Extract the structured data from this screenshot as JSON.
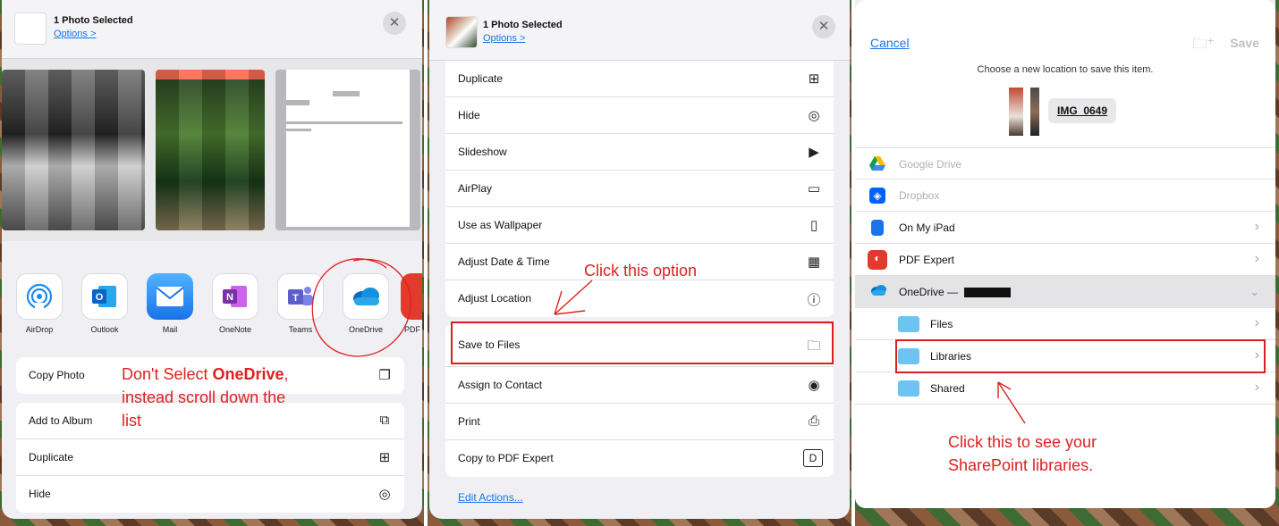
{
  "share_sheet": {
    "title": "1 Photo Selected",
    "options_link": "Options >",
    "close_glyph": "✕",
    "apps": [
      {
        "label": "AirDrop",
        "icon": "airdrop-icon",
        "color": "#ffffff"
      },
      {
        "label": "Outlook",
        "icon": "outlook-icon",
        "color": "#0a64c8"
      },
      {
        "label": "Mail",
        "icon": "mail-icon",
        "color": "#2b8cf5"
      },
      {
        "label": "OneNote",
        "icon": "onenote-icon",
        "color": "#7b2fa8"
      },
      {
        "label": "Teams",
        "icon": "teams-icon",
        "color": "#5b5fc7"
      },
      {
        "label": "OneDrive",
        "icon": "onedrive-icon",
        "color": "#0f6cbd"
      },
      {
        "label": "PDF",
        "icon": "pdf-expert-icon",
        "color": "#e23b2e"
      }
    ],
    "actions": [
      {
        "label": "Copy Photo",
        "icon": "copy-icon"
      },
      {
        "label": "Add to Album",
        "icon": "album-add-icon"
      },
      {
        "label": "Duplicate",
        "icon": "duplicate-icon"
      },
      {
        "label": "Hide",
        "icon": "hide-eye-icon"
      }
    ]
  },
  "actions_sheet": {
    "title": "1 Photo Selected",
    "options_link": "Options >",
    "close_glyph": "✕",
    "group1": [
      {
        "label": "Duplicate",
        "icon": "duplicate-icon"
      },
      {
        "label": "Hide",
        "icon": "hide-eye-icon"
      },
      {
        "label": "Slideshow",
        "icon": "slideshow-play-icon"
      },
      {
        "label": "AirPlay",
        "icon": "airplay-icon"
      },
      {
        "label": "Use as Wallpaper",
        "icon": "phone-icon"
      },
      {
        "label": "Adjust Date & Time",
        "icon": "calendar-icon"
      },
      {
        "label": "Adjust Location",
        "icon": "location-info-icon"
      }
    ],
    "group2": [
      {
        "label": "Save to Files",
        "icon": "folder-icon"
      },
      {
        "label": "Assign to Contact",
        "icon": "contact-icon"
      },
      {
        "label": "Print",
        "icon": "printer-icon"
      },
      {
        "label": "Copy to PDF Expert",
        "icon": "pdf-expert-icon"
      }
    ],
    "edit_actions": "Edit Actions..."
  },
  "files_picker": {
    "cancel": "Cancel",
    "save": "Save",
    "prompt": "Choose a new location to save this item.",
    "filename": "IMG_0649",
    "locations": [
      {
        "label": "Google Drive",
        "icon": "google-drive-icon",
        "color": "#fbbc04",
        "enabled": false
      },
      {
        "label": "Dropbox",
        "icon": "dropbox-icon",
        "color": "#0061ff",
        "enabled": false
      },
      {
        "label": "On My iPad",
        "icon": "ipad-icon",
        "color": "#1a73e8",
        "enabled": true
      },
      {
        "label": "PDF Expert",
        "icon": "pdf-expert-icon",
        "color": "#e23b2e",
        "enabled": true
      },
      {
        "label": "OneDrive — ",
        "icon": "onedrive-icon",
        "color": "#0f6cbd",
        "enabled": true
      }
    ],
    "subfolders": [
      {
        "label": "Files",
        "icon": "folder-icon"
      },
      {
        "label": "Libraries",
        "icon": "folder-icon"
      },
      {
        "label": "Shared",
        "icon": "folder-icon"
      }
    ]
  },
  "annotations": {
    "dont_select_pre": "Don't Select ",
    "dont_select_bold": "OneDrive",
    "dont_select_post": ",",
    "dont_select_line2": "instead scroll down the",
    "dont_select_line3": "list",
    "click_option": "Click this option",
    "click_libraries_1": "Click this to see your",
    "click_libraries_2": "SharePoint libraries."
  },
  "colors": {
    "accent_blue": "#1a73e8",
    "annotation_red": "#e02020"
  }
}
